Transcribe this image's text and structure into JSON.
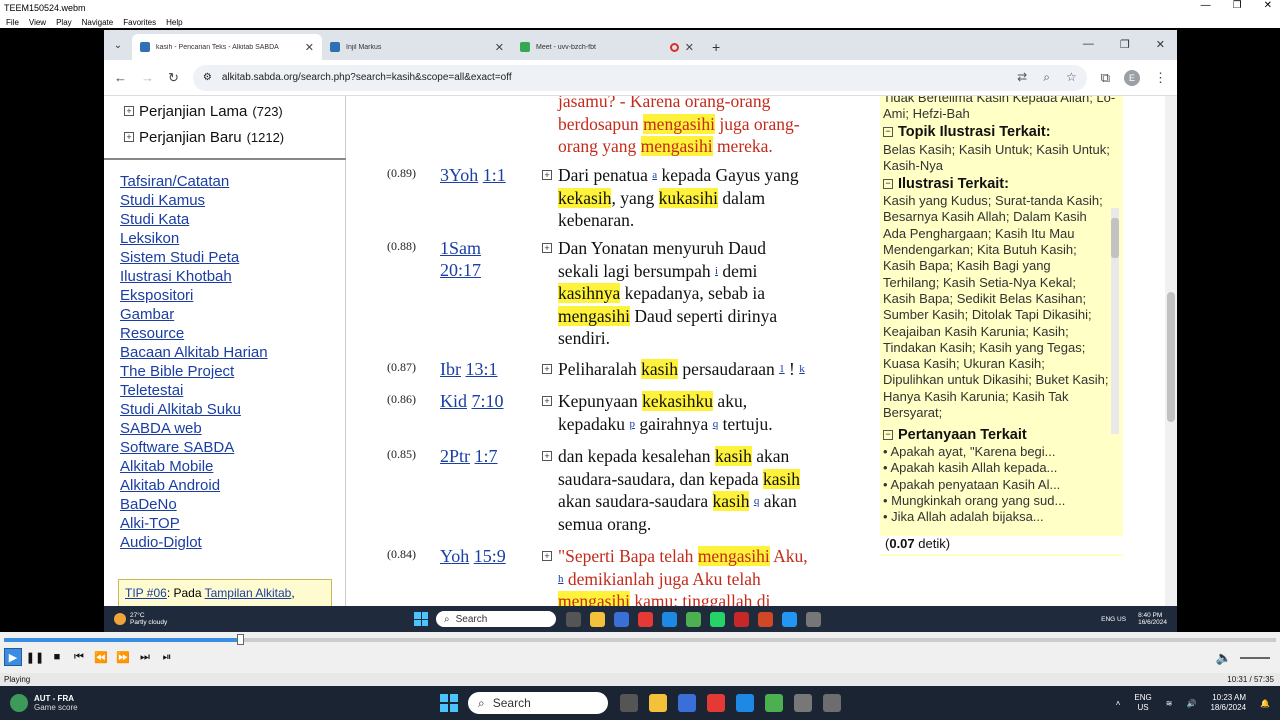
{
  "player": {
    "title": "TEEM150524.webm",
    "menu": [
      "File",
      "View",
      "Play",
      "Navigate",
      "Favorites",
      "Help"
    ],
    "status": "Playing",
    "time": "10:31 / 57:35",
    "progress": 0.183
  },
  "browser": {
    "tabs": [
      {
        "label": "kasih - Pencarian Teks - Alkitab SABDA",
        "active": true
      },
      {
        "label": "Injil Markus",
        "active": false
      },
      {
        "label": "Meet - uvv-bzch-fbt",
        "active": false
      }
    ],
    "url": "alkitab.sabda.org/search.php?search=kasih&scope=all&exact=off",
    "profile_initial": "E"
  },
  "sidebar": {
    "tree": [
      {
        "label": "Perjanjian Lama",
        "count": "(723)"
      },
      {
        "label": "Perjanjian Baru",
        "count": "(1212)"
      }
    ],
    "links": [
      "Tafsiran/Catatan",
      "Studi Kamus",
      "Studi Kata",
      "Leksikon",
      "Sistem Studi Peta",
      "Ilustrasi Khotbah",
      "Ekspositori",
      "Gambar",
      "Resource",
      "Bacaan Alkitab Harian",
      "The Bible Project",
      "Teletestai",
      "Studi Alkitab Suku",
      "SABDA web",
      "Software SABDA",
      "Alkitab Mobile",
      "Alkitab Android",
      "BaDeNo",
      "Alki-TOP",
      "Audio-Diglot"
    ],
    "tip_label": "TIP #06",
    "tip_text": ": Pada ",
    "tip_link": "Tampilan Alkitab"
  },
  "results": {
    "top_line1": "jasamu? - Karena orang-orang",
    "top_line2a": "berdosapun ",
    "top_hl1": "mengasihi",
    "top_line2b": " juga orang-",
    "top_line3a": "orang yang ",
    "top_hl2": "mengasihi",
    "top_line3b": " mereka.",
    "r1": {
      "score": "(0.89)",
      "book": "3Yoh",
      "ref": "1:1",
      "t1": "Dari penatua ",
      "s1": "a",
      "t2": " kepada Gayus yang",
      "h1": "kekasih",
      "t3": ", yang ",
      "h2": "kukasihi",
      "t4": " dalam",
      "t5": "kebenaran."
    },
    "r2": {
      "score": "(0.88)",
      "book": "1Sam",
      "ref": "20:17",
      "t1": "Dan Yonatan menyuruh Daud",
      "t2": "sekali lagi bersumpah ",
      "s1": "i",
      "t3": " demi",
      "h1": "kasihnya",
      "t4": " kepadanya, sebab ia",
      "h2": "mengasihi",
      "t5": " Daud seperti dirinya",
      "t6": "sendiri."
    },
    "r3": {
      "score": "(0.87)",
      "book": "Ibr",
      "ref": "13:1",
      "t1": "Peliharalah ",
      "h1": "kasih",
      "t2": " persaudaraan ",
      "s1": "1",
      "t3": " ! ",
      "s2": "k"
    },
    "r4": {
      "score": "(0.86)",
      "book": "Kid",
      "ref": "7:10",
      "t1": "Kepunyaan ",
      "h1": "kekasihku",
      "t2": " aku,",
      "t3": "kepadaku ",
      "s1": "p",
      "t4": " gairahnya ",
      "s2": "q",
      "t5": " tertuju."
    },
    "r5": {
      "score": "(0.85)",
      "book": "2Ptr",
      "ref": "1:7",
      "t1": "dan kepada kesalehan ",
      "h1": "kasih",
      "t2": " akan",
      "t3": "saudara-saudara, dan kepada ",
      "h2": "kasih",
      "t4": "akan saudara-saudara ",
      "h3": "kasih",
      "s1": "q",
      "t5": " akan",
      "t6": "semua orang."
    },
    "r6": {
      "score": "(0.84)",
      "book": "Yoh",
      "ref": "15:9",
      "t1": "\"Seperti Bapa telah ",
      "h1": "mengasihi",
      "t2": " Aku,",
      "s1": "h",
      "t3": " demikianlah juga Aku telah",
      "h2": "mengasihi",
      "t4": " kamu; tinggallah di"
    }
  },
  "rightpanel": {
    "top_text": "Tidak Bertelima Kasih Kepada Allah; Lo-Ami; Hefzi-Bah",
    "topik_head": "Topik Ilustrasi Terkait:",
    "topik_text": "Belas Kasih; Kasih Untuk; Kasih Untuk; Kasih-Nya",
    "ilustrasi_head": "Ilustrasi Terkait:",
    "ilustrasi_text": "Kasih yang Kudus; Surat-tanda Kasih; Besarnya Kasih Allah; Dalam Kasih Ada Penghargaan; Kasih Itu Mau Mendengarkan; Kita Butuh Kasih; Kasih Bapa; Kasih Bagi yang Terhilang; Kasih Setia-Nya Kekal; Kasih Bapa; Sedikit Belas Kasihan; Sumber Kasih; Ditolak Tapi Dikasihi; Keajaiban Kasih Karunia; Kasih; Tindakan Kasih; Kasih yang Tegas; Kuasa Kasih; Ukuran Kasih; Dipulihkan untuk Dikasihi; Buket Kasih; Hanya Kasih Karunia; Kasih Tak Bersyarat;",
    "pertanyaan_head": "Pertanyaan Terkait",
    "questions": [
      "• Apakah ayat, \"Karena begi...",
      "• Apakah kasih Allah kepada...",
      "• Apakah penyataan Kasih Al...",
      "• Mungkinkah orang yang sud...",
      "• Jika Allah adalah bijaksa..."
    ],
    "timing_value": "0.07",
    "timing_unit": " detik)"
  },
  "inner_taskbar": {
    "temp": "27°C",
    "weather": "Partly cloudy",
    "search": "Search",
    "lang": "ENG US",
    "time": "8:40 PM",
    "date": "16/6/2024"
  },
  "taskbar": {
    "game_title": "AUT - FRA",
    "game_sub": "Game score",
    "search": "Search",
    "lang1": "ENG",
    "lang2": "US",
    "time": "10:23 AM",
    "date": "18/6/2024"
  }
}
